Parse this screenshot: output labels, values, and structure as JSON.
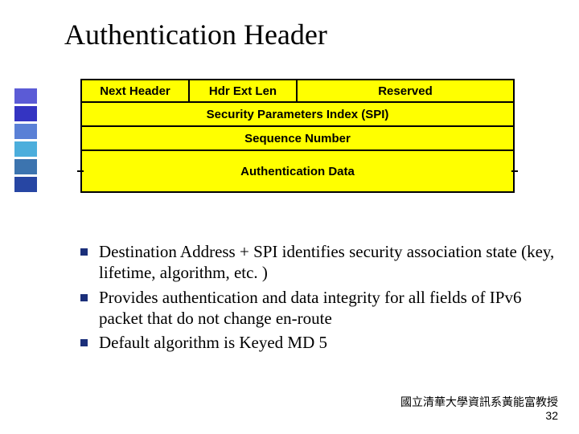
{
  "title": "Authentication Header",
  "packet": {
    "row1": {
      "next_header": "Next Header",
      "hdr_ext_len": "Hdr Ext Len",
      "reserved": "Reserved"
    },
    "row2": "Security Parameters Index (SPI)",
    "row3": "Sequence Number",
    "row4": "Authentication Data"
  },
  "bullets": [
    "Destination Address + SPI identifies security association state (key, lifetime, algorithm, etc. )",
    "Provides authentication and data integrity for all fields of IPv6 packet that do not change en-route",
    "Default algorithm is Keyed MD 5"
  ],
  "footer": {
    "affiliation": "國立清華大學資訊系黃能富教授",
    "page": "32"
  }
}
